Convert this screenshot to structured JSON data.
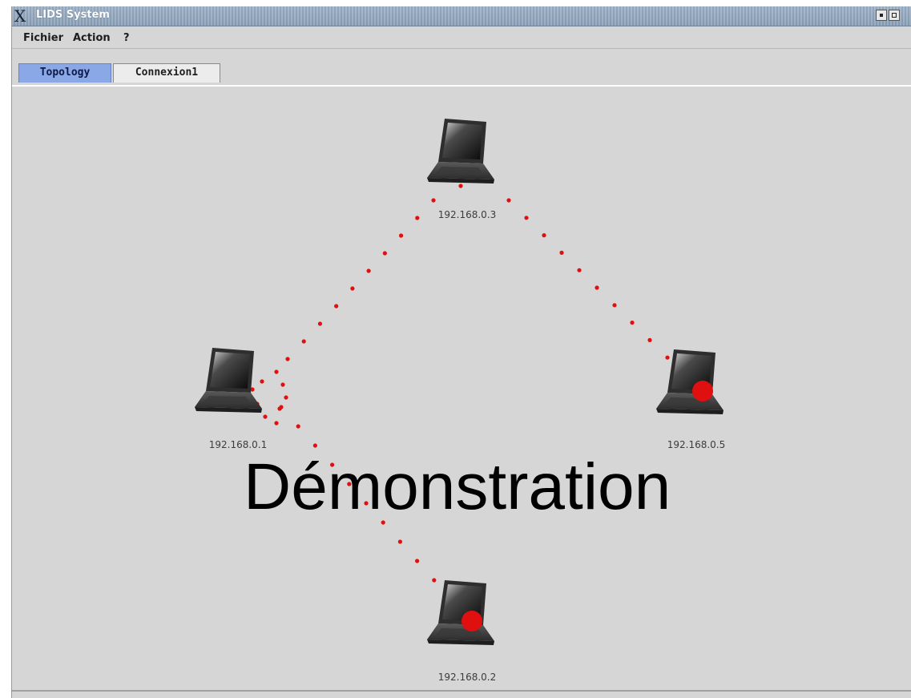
{
  "window": {
    "title": "LIDS System"
  },
  "menu": {
    "items": [
      "Fichier",
      "Action",
      "?"
    ]
  },
  "tabs": [
    {
      "label": "Topology",
      "active": true
    },
    {
      "label": "Connexion1",
      "active": false
    }
  ],
  "topology": {
    "nodes": [
      {
        "id": "n3",
        "label": "192.168.0.3",
        "alert": false
      },
      {
        "id": "n1",
        "label": "192.168.0.1",
        "alert": false
      },
      {
        "id": "n5",
        "label": "192.168.0.5",
        "alert": true
      },
      {
        "id": "n2",
        "label": "192.168.0.2",
        "alert": true
      }
    ],
    "packet_color": "#e01010"
  },
  "overlay": {
    "demonstration": "Démonstration"
  },
  "colors": {
    "titlebar": "#8aa0b8",
    "active_tab": "#8aa7e6",
    "background": "#d6d6d6"
  }
}
